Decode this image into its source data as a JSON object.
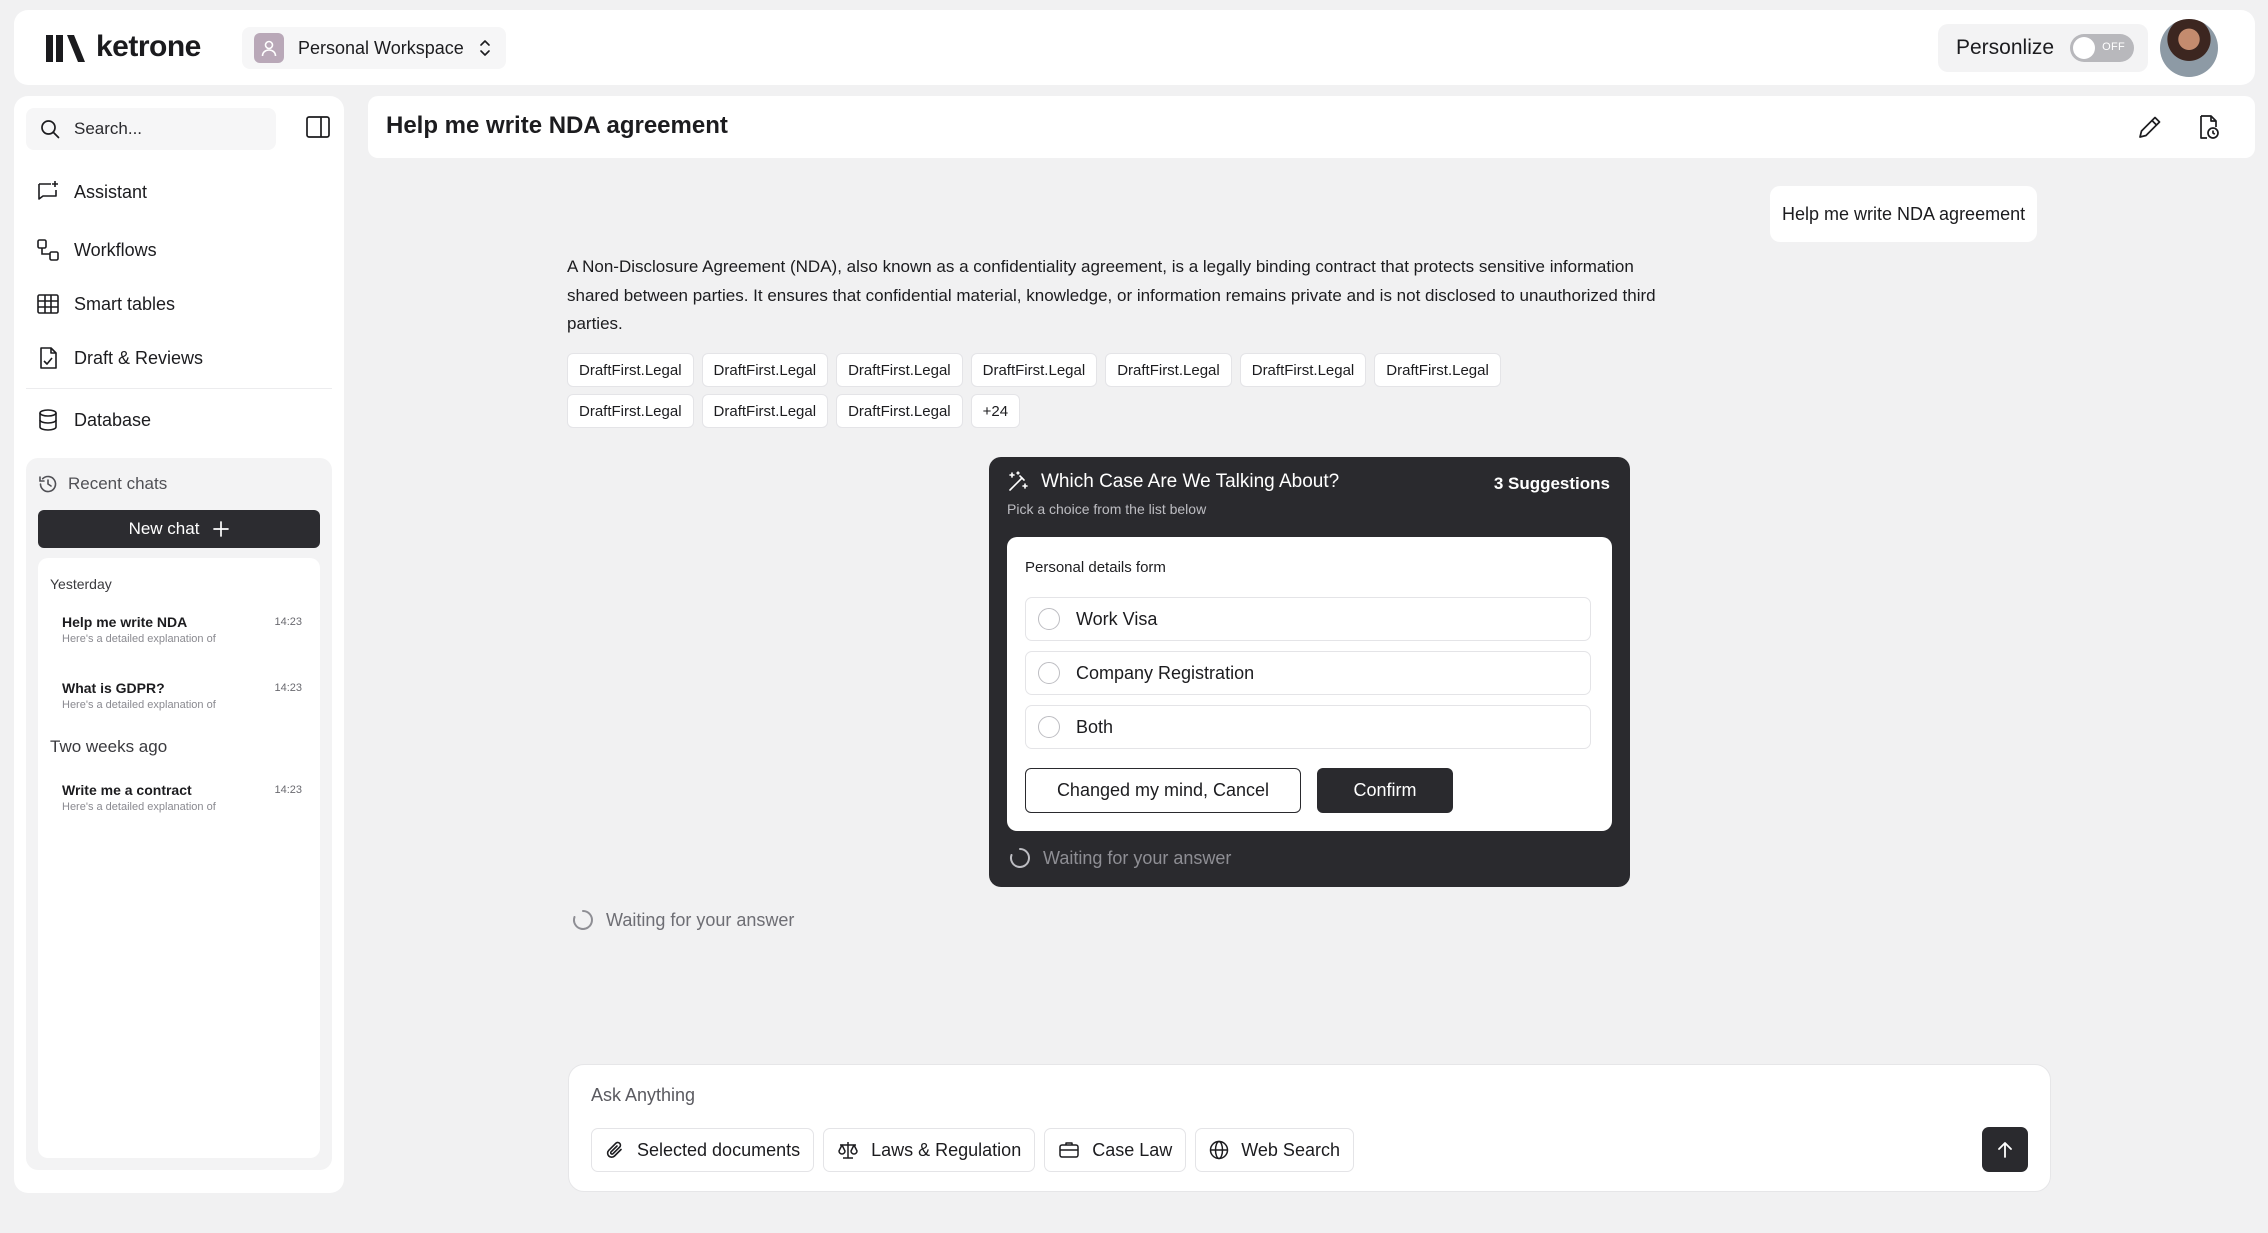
{
  "brand": {
    "name": "ketrone"
  },
  "workspace": {
    "label": "Personal Workspace"
  },
  "personalize": {
    "label": "Personlize",
    "toggle_state": "OFF"
  },
  "sidebar": {
    "search_placeholder": "Search...",
    "nav": [
      {
        "label": "Assistant",
        "icon": "assistant-icon"
      },
      {
        "label": "Workflows",
        "icon": "workflows-icon"
      },
      {
        "label": "Smart tables",
        "icon": "table-icon"
      },
      {
        "label": "Draft & Reviews",
        "icon": "draft-icon"
      },
      {
        "label": "Database",
        "icon": "database-icon"
      }
    ],
    "recent": {
      "title": "Recent chats",
      "new_chat": "New chat",
      "groups": [
        {
          "label": "Yesterday"
        },
        {
          "label": "Two weeks ago"
        }
      ],
      "chats": [
        {
          "title": "Help me write NDA",
          "preview": "Here's a detailed explanation of",
          "time": "14:23"
        },
        {
          "title": "What is GDPR?",
          "preview": "Here's a detailed explanation of",
          "time": "14:23"
        },
        {
          "title": "Write me a contract",
          "preview": "Here's a detailed explanation of",
          "time": "14:23"
        }
      ]
    }
  },
  "main": {
    "title": "Help me write NDA agreement",
    "user_message": "Help me write NDA agreement",
    "assistant_message": "A Non-Disclosure Agreement (NDA), also known as a confidentiality agreement, is a legally binding contract that protects sensitive information shared between parties. It ensures that confidential material, knowledge, or information remains private and is not disclosed to unauthorized third parties.",
    "sources": [
      "DraftFirst.Legal",
      "DraftFirst.Legal",
      "DraftFirst.Legal",
      "DraftFirst.Legal",
      "DraftFirst.Legal",
      "DraftFirst.Legal",
      "DraftFirst.Legal",
      "DraftFirst.Legal",
      "DraftFirst.Legal",
      "DraftFirst.Legal"
    ],
    "sources_more": "+24",
    "waiting": "Waiting for your answer"
  },
  "suggestion_card": {
    "title": "Which Case Are We Talking About?",
    "count": "3 Suggestions",
    "subtitle": "Pick a choice from the list below",
    "form_label": "Personal details form",
    "options": [
      "Work Visa",
      "Company Registration",
      "Both"
    ],
    "cancel": "Changed my mind, Cancel",
    "confirm": "Confirm",
    "waiting": "Waiting for your answer"
  },
  "composer": {
    "placeholder": "Ask Anything",
    "tools": [
      {
        "label": "Selected documents",
        "icon": "paperclip-icon"
      },
      {
        "label": "Laws & Regulation",
        "icon": "scales-icon"
      },
      {
        "label": "Case Law",
        "icon": "briefcase-icon"
      },
      {
        "label": "Web Search",
        "icon": "globe-icon"
      }
    ]
  }
}
